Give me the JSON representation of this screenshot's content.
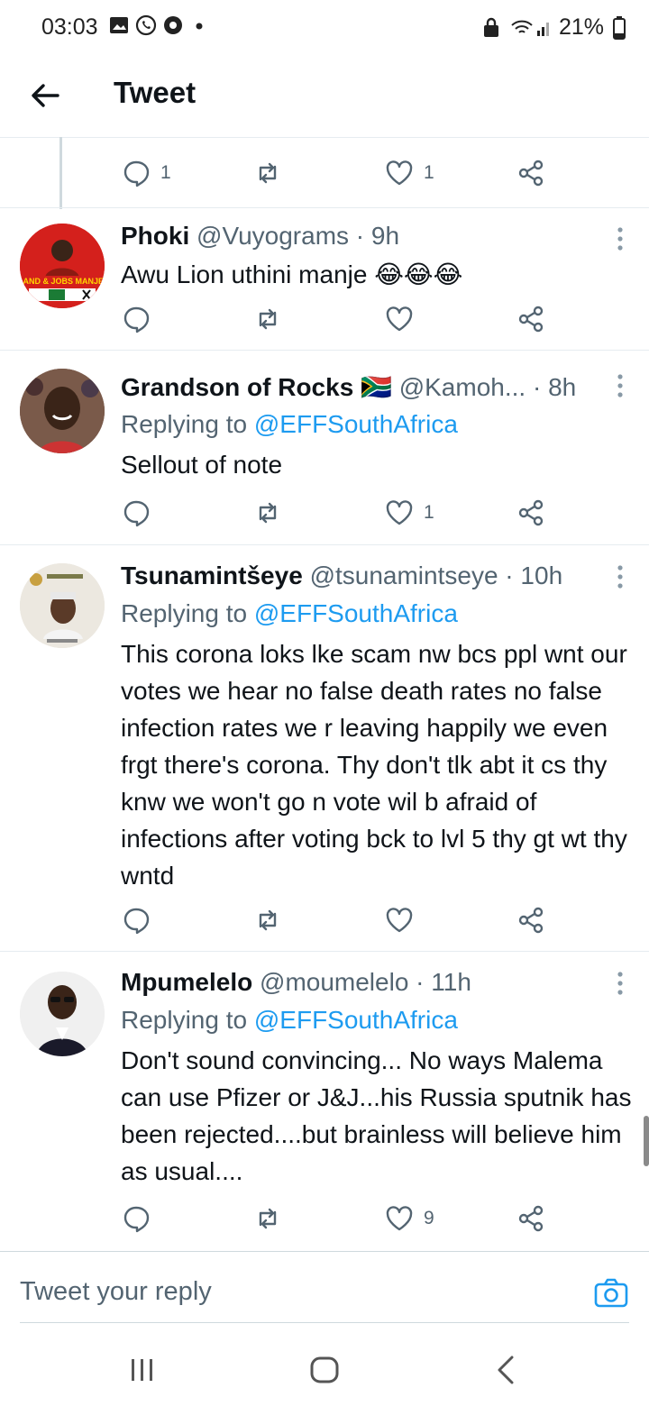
{
  "status_bar": {
    "time": "03:03",
    "battery": "21%"
  },
  "header": {
    "title": "Tweet"
  },
  "top_actions": {
    "reply_count": "1",
    "like_count": "1"
  },
  "tweets": [
    {
      "name": "Phoki",
      "handle": "@Vuyograms",
      "sep": " · ",
      "time": "9h",
      "replying_label": "",
      "replying_to": "",
      "text": "Awu Lion uthini manje 😂😂😂",
      "replies": "",
      "likes": ""
    },
    {
      "name": "Grandson of Rocks",
      "flag": "🇿🇦",
      "handle": "@Kamoh...",
      "sep": " · ",
      "time": "8h",
      "replying_label": "Replying to ",
      "replying_to": "@EFFSouthAfrica",
      "text": "Sellout of note",
      "replies": "",
      "likes": "1"
    },
    {
      "name": "Tsunamintšeye",
      "handle": "@tsunamintseye",
      "sep": " · ",
      "time": "10h",
      "replying_label": "Replying to ",
      "replying_to": "@EFFSouthAfrica",
      "text": "This corona loks lke scam nw bcs ppl wnt our votes we hear no false death rates no false infection rates we r leaving happily we even frgt there's corona. Thy don't tlk abt it cs thy knw we won't go n vote wil b afraid of infections after voting bck to lvl 5 thy gt wt thy wntd",
      "replies": "",
      "likes": ""
    },
    {
      "name": "Mpumelelo",
      "handle": "@moumelelo",
      "sep": " · ",
      "time": "11h",
      "replying_label": "Replying to ",
      "replying_to": "@EFFSouthAfrica",
      "text": "Don't sound convincing... No ways Malema can use Pfizer or J&J...his Russia sputnik has been rejected....but brainless will believe him as usual....",
      "replies": "",
      "likes": "9"
    }
  ],
  "avatars": {
    "phoki_banner": "LAND & JOBS MANJE!"
  },
  "reply_bar": {
    "placeholder": "Tweet your reply"
  },
  "icons": [
    "back-arrow-icon",
    "reply-icon",
    "retweet-icon",
    "like-icon",
    "share-icon",
    "more-icon",
    "camera-icon"
  ],
  "colors": {
    "link": "#1d9bf0",
    "muted": "#536471",
    "text": "#0f1419"
  }
}
